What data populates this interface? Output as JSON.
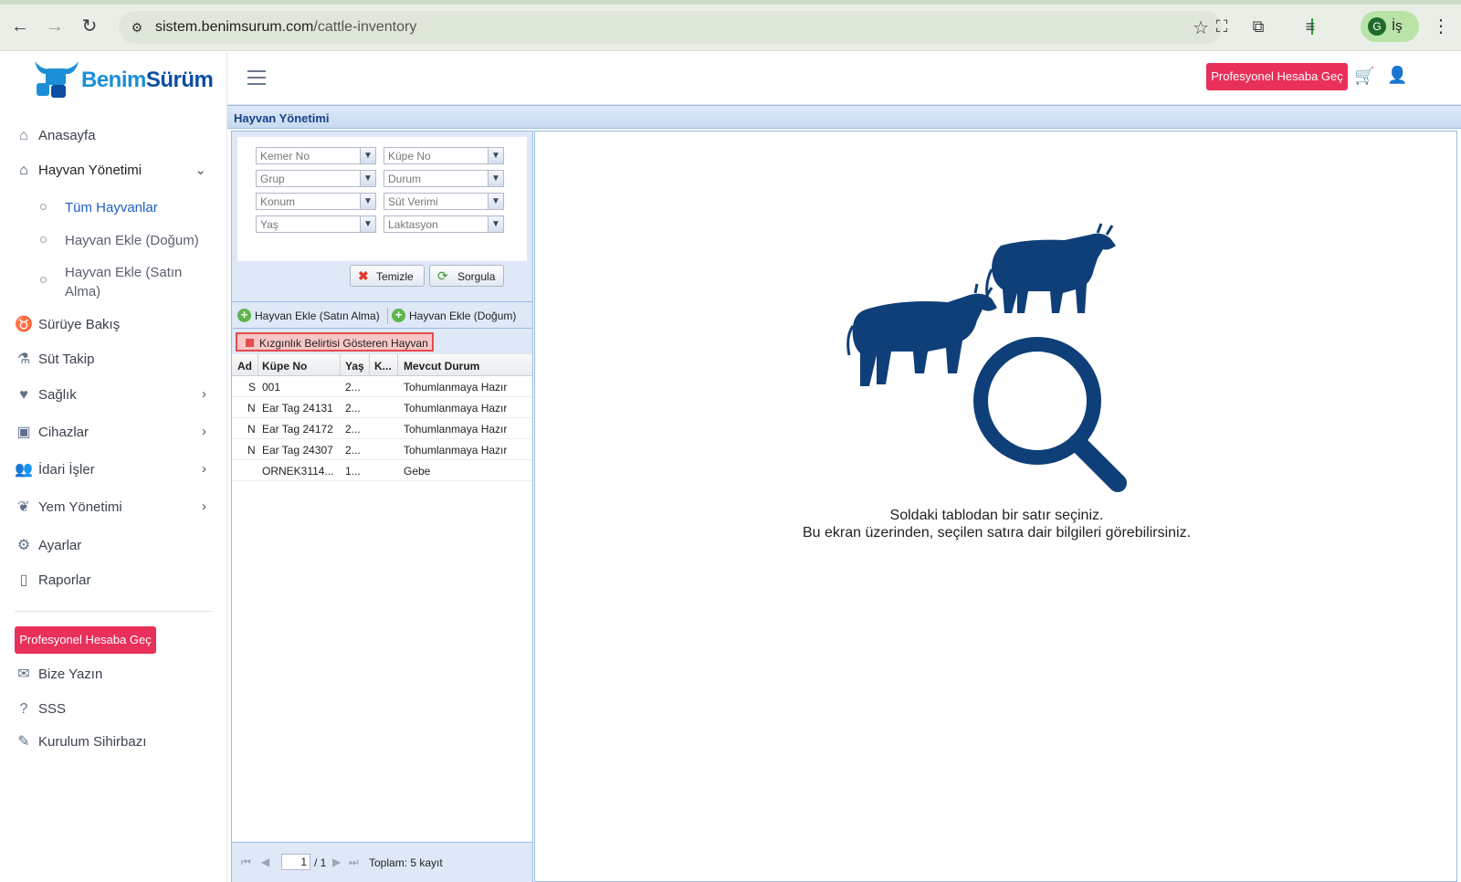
{
  "browser": {
    "url_host": "sistem.benimsurum.com",
    "url_path": "/cattle-inventory",
    "profile_initial": "G",
    "profile_label": "İş"
  },
  "brand": {
    "part1": "Benim",
    "part2": "Sürüm"
  },
  "sidebar": {
    "items": [
      {
        "label": "Anasayfa",
        "icon": "home-icon"
      },
      {
        "label": "Hayvan Yönetimi",
        "icon": "barn-icon"
      },
      {
        "label": "Sürüye Bakış",
        "icon": "cow-face-icon"
      },
      {
        "label": "Süt Takip",
        "icon": "flask-icon"
      },
      {
        "label": "Sağlık",
        "icon": "hand-heart-icon"
      },
      {
        "label": "Cihazlar",
        "icon": "devices-icon"
      },
      {
        "label": "İdari İşler",
        "icon": "users-gear-icon"
      },
      {
        "label": "Yem Yönetimi",
        "icon": "feed-icon"
      },
      {
        "label": "Ayarlar",
        "icon": "gear-icon"
      },
      {
        "label": "Raporlar",
        "icon": "document-icon"
      }
    ],
    "sub_items": [
      "Tüm Hayvanlar",
      "Hayvan Ekle (Doğum)",
      "Hayvan Ekle (Satın Alma)"
    ],
    "pro_button": "Profesyonel Hesaba Geç",
    "bottom_items": [
      {
        "label": "Bize Yazın",
        "icon": "contact-icon"
      },
      {
        "label": "SSS",
        "icon": "question-icon"
      },
      {
        "label": "Kurulum Sihirbazı",
        "icon": "wand-icon"
      }
    ]
  },
  "header": {
    "pro_button": "Profesyonel Hesaba Geç"
  },
  "panel": {
    "title": "Hayvan Yönetimi"
  },
  "filters": {
    "kemer_no": "Kemer No",
    "kupe_no": "Küpe No",
    "grup": "Grup",
    "durum": "Durum",
    "konum": "Konum",
    "sut_verimi": "Süt Verimi",
    "yas": "Yaş",
    "laktasyon": "Laktasyon",
    "clear_label": "Temizle",
    "query_label": "Sorgula"
  },
  "toolbar": {
    "add_purchase": "Hayvan Ekle (Satın Alma)",
    "add_birth": "Hayvan Ekle (Doğum)",
    "heat_button": "Kızgınlık Belirtisi Gösteren Hayvan"
  },
  "grid": {
    "columns": [
      "Ad",
      "Küpe No",
      "Yaş",
      "K...",
      "Mevcut Durum"
    ],
    "rows": [
      {
        "ad": "S",
        "kupe": "001",
        "yas": "2...",
        "k": "",
        "durum": "Tohumlanmaya Hazır"
      },
      {
        "ad": "N",
        "kupe": "Ear Tag 24131",
        "yas": "2...",
        "k": "",
        "durum": "Tohumlanmaya Hazır"
      },
      {
        "ad": "N",
        "kupe": "Ear Tag 24172",
        "yas": "2...",
        "k": "",
        "durum": "Tohumlanmaya Hazır"
      },
      {
        "ad": "N",
        "kupe": "Ear Tag 24307",
        "yas": "2...",
        "k": "",
        "durum": "Tohumlanmaya Hazır"
      },
      {
        "ad": "",
        "kupe": "ORNEK3114...",
        "yas": "1...",
        "k": "",
        "durum": "Gebe"
      }
    ]
  },
  "pager": {
    "page": "1",
    "of": "/ 1",
    "total": "Toplam: 5 kayıt"
  },
  "detail": {
    "line1": "Soldaki tablodan bir satır seçiniz.",
    "line2": "Bu ekran üzerinden, seçilen satıra dair bilgileri görebilirsiniz."
  },
  "colors": {
    "accent_pink": "#e9305a",
    "brand_navy": "#0f3f78",
    "ext_blue": "#15428b"
  }
}
